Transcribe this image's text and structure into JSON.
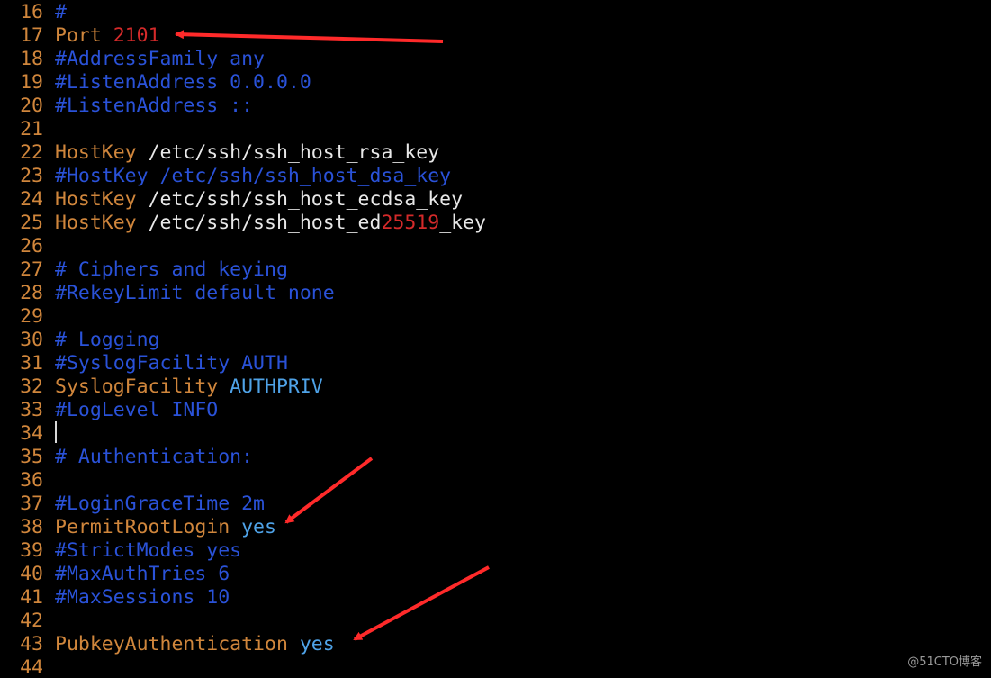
{
  "colors": {
    "line_number": "#d0863c",
    "comment": "#2a52d8",
    "keyword": "#d0863c",
    "value": "#e8e8e8",
    "number": "#d42a2a",
    "constant": "#4fa3e8",
    "arrow": "#ff2a2a",
    "background": "#000000"
  },
  "lines": [
    {
      "n": "16",
      "tokens": [
        {
          "t": "#",
          "c": "comment"
        }
      ]
    },
    {
      "n": "17",
      "tokens": [
        {
          "t": "Port ",
          "c": "keyword"
        },
        {
          "t": "2101",
          "c": "number"
        }
      ]
    },
    {
      "n": "18",
      "tokens": [
        {
          "t": "#AddressFamily any",
          "c": "comment"
        }
      ]
    },
    {
      "n": "19",
      "tokens": [
        {
          "t": "#ListenAddress 0.0.0.0",
          "c": "comment"
        }
      ]
    },
    {
      "n": "20",
      "tokens": [
        {
          "t": "#ListenAddress ::",
          "c": "comment"
        }
      ]
    },
    {
      "n": "21",
      "tokens": []
    },
    {
      "n": "22",
      "tokens": [
        {
          "t": "HostKey ",
          "c": "keyword"
        },
        {
          "t": "/etc/ssh/ssh_host_rsa_key",
          "c": "value"
        }
      ]
    },
    {
      "n": "23",
      "tokens": [
        {
          "t": "#HostKey /etc/ssh/ssh_host_dsa_key",
          "c": "comment"
        }
      ]
    },
    {
      "n": "24",
      "tokens": [
        {
          "t": "HostKey ",
          "c": "keyword"
        },
        {
          "t": "/etc/ssh/ssh_host_ecdsa_key",
          "c": "value"
        }
      ]
    },
    {
      "n": "25",
      "tokens": [
        {
          "t": "HostKey ",
          "c": "keyword"
        },
        {
          "t": "/etc/ssh/ssh_host_ed",
          "c": "value"
        },
        {
          "t": "25519",
          "c": "number"
        },
        {
          "t": "_key",
          "c": "value"
        }
      ]
    },
    {
      "n": "26",
      "tokens": []
    },
    {
      "n": "27",
      "tokens": [
        {
          "t": "# Ciphers and keying",
          "c": "comment"
        }
      ]
    },
    {
      "n": "28",
      "tokens": [
        {
          "t": "#RekeyLimit default none",
          "c": "comment"
        }
      ]
    },
    {
      "n": "29",
      "tokens": []
    },
    {
      "n": "30",
      "tokens": [
        {
          "t": "# Logging",
          "c": "comment"
        }
      ]
    },
    {
      "n": "31",
      "tokens": [
        {
          "t": "#SyslogFacility AUTH",
          "c": "comment"
        }
      ]
    },
    {
      "n": "32",
      "tokens": [
        {
          "t": "SyslogFacility ",
          "c": "keyword"
        },
        {
          "t": "AUTHPRIV",
          "c": "constant"
        }
      ]
    },
    {
      "n": "33",
      "tokens": [
        {
          "t": "#LogLevel INFO",
          "c": "comment"
        }
      ]
    },
    {
      "n": "34",
      "tokens": []
    },
    {
      "n": "35",
      "tokens": [
        {
          "t": "# Authentication:",
          "c": "comment"
        }
      ]
    },
    {
      "n": "36",
      "tokens": []
    },
    {
      "n": "37",
      "tokens": [
        {
          "t": "#LoginGraceTime 2m",
          "c": "comment"
        }
      ]
    },
    {
      "n": "38",
      "tokens": [
        {
          "t": "PermitRootLogin ",
          "c": "keyword"
        },
        {
          "t": "yes",
          "c": "constant"
        }
      ]
    },
    {
      "n": "39",
      "tokens": [
        {
          "t": "#StrictModes yes",
          "c": "comment"
        }
      ]
    },
    {
      "n": "40",
      "tokens": [
        {
          "t": "#MaxAuthTries 6",
          "c": "comment"
        }
      ]
    },
    {
      "n": "41",
      "tokens": [
        {
          "t": "#MaxSessions 10",
          "c": "comment"
        }
      ]
    },
    {
      "n": "42",
      "tokens": []
    },
    {
      "n": "43",
      "tokens": [
        {
          "t": "PubkeyAuthentication ",
          "c": "keyword"
        },
        {
          "t": "yes",
          "c": "constant"
        }
      ]
    },
    {
      "n": "44",
      "tokens": []
    }
  ],
  "watermark": "@51CTO博客"
}
